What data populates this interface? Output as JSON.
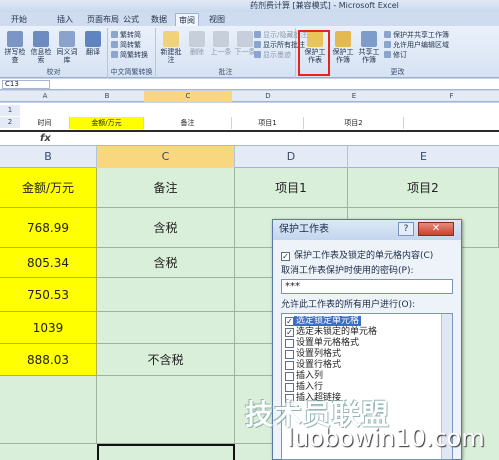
{
  "window": {
    "title": "药剂费计算 [兼容模式] - Microsoft Excel"
  },
  "tabs": [
    "开始",
    "插入",
    "页面布局",
    "公式",
    "数据",
    "审阅",
    "视图"
  ],
  "active_tab": "审阅",
  "ribbon": {
    "groups": [
      {
        "label": "校对",
        "buttons": [
          "拼写检查",
          "信息检索",
          "同义词库",
          "翻译"
        ]
      },
      {
        "label": "中文简繁转换",
        "items": [
          "繁转简",
          "简转繁",
          "简繁转换"
        ]
      },
      {
        "label": "批注",
        "buttons": [
          "新建批注",
          "删除",
          "上一条",
          "下一条"
        ],
        "items": [
          "显示/隐藏批注",
          "显示所有批注",
          "显示墨迹"
        ]
      },
      {
        "label": "更改",
        "buttons": [
          "保护工作表",
          "保护工作簿",
          "共享工作簿"
        ],
        "items": [
          "保护并共享工作簿",
          "允许用户编辑区域",
          "修订"
        ]
      }
    ]
  },
  "name_box": "C13",
  "small_sheet": {
    "columns": [
      "A",
      "B",
      "C",
      "D",
      "E",
      "F"
    ],
    "row_numbers": [
      "1",
      "2"
    ],
    "cells": [
      "时间",
      "金额/万元",
      "备注",
      "项目1",
      "项目2"
    ]
  },
  "formula_bar": {
    "fx": "fx"
  },
  "sheet": {
    "columns": [
      "B",
      "C",
      "D",
      "E"
    ],
    "header_row": {
      "amount": "金额/万元",
      "note": "备注",
      "item1": "项目1",
      "item2": "项目2"
    },
    "rows": [
      {
        "amount": "768.99",
        "note": "含税"
      },
      {
        "amount": "805.34",
        "note": "含税"
      },
      {
        "amount": "750.53",
        "note": ""
      },
      {
        "amount": "1039",
        "note": ""
      },
      {
        "amount": "888.03",
        "note": "不含税"
      }
    ]
  },
  "dialog": {
    "title": "保护工作表",
    "help": "?",
    "close": "✕",
    "protect_label": "保护工作表及锁定的单元格内容(C)",
    "password_label": "取消工作表保护时使用的密码(P):",
    "password_value": "***",
    "permissions_label": "允许此工作表的所有用户进行(O):",
    "permissions": [
      {
        "label": "选定锁定单元格",
        "checked": true,
        "selected": true
      },
      {
        "label": "选定未锁定的单元格",
        "checked": true
      },
      {
        "label": "设置单元格格式",
        "checked": false
      },
      {
        "label": "设置列格式",
        "checked": false
      },
      {
        "label": "设置行格式",
        "checked": false
      },
      {
        "label": "插入列",
        "checked": false
      },
      {
        "label": "插入行",
        "checked": false
      },
      {
        "label": "插入超链接",
        "checked": false
      }
    ]
  },
  "watermark": {
    "brand": "技术员联盟",
    "url": "luobowin10.com"
  },
  "colors": {
    "yellow_cell": "#ffff00",
    "green_cell": "#d9efd9",
    "highlight_red": "#e0261c",
    "selection_blue": "#3b6fc2"
  }
}
